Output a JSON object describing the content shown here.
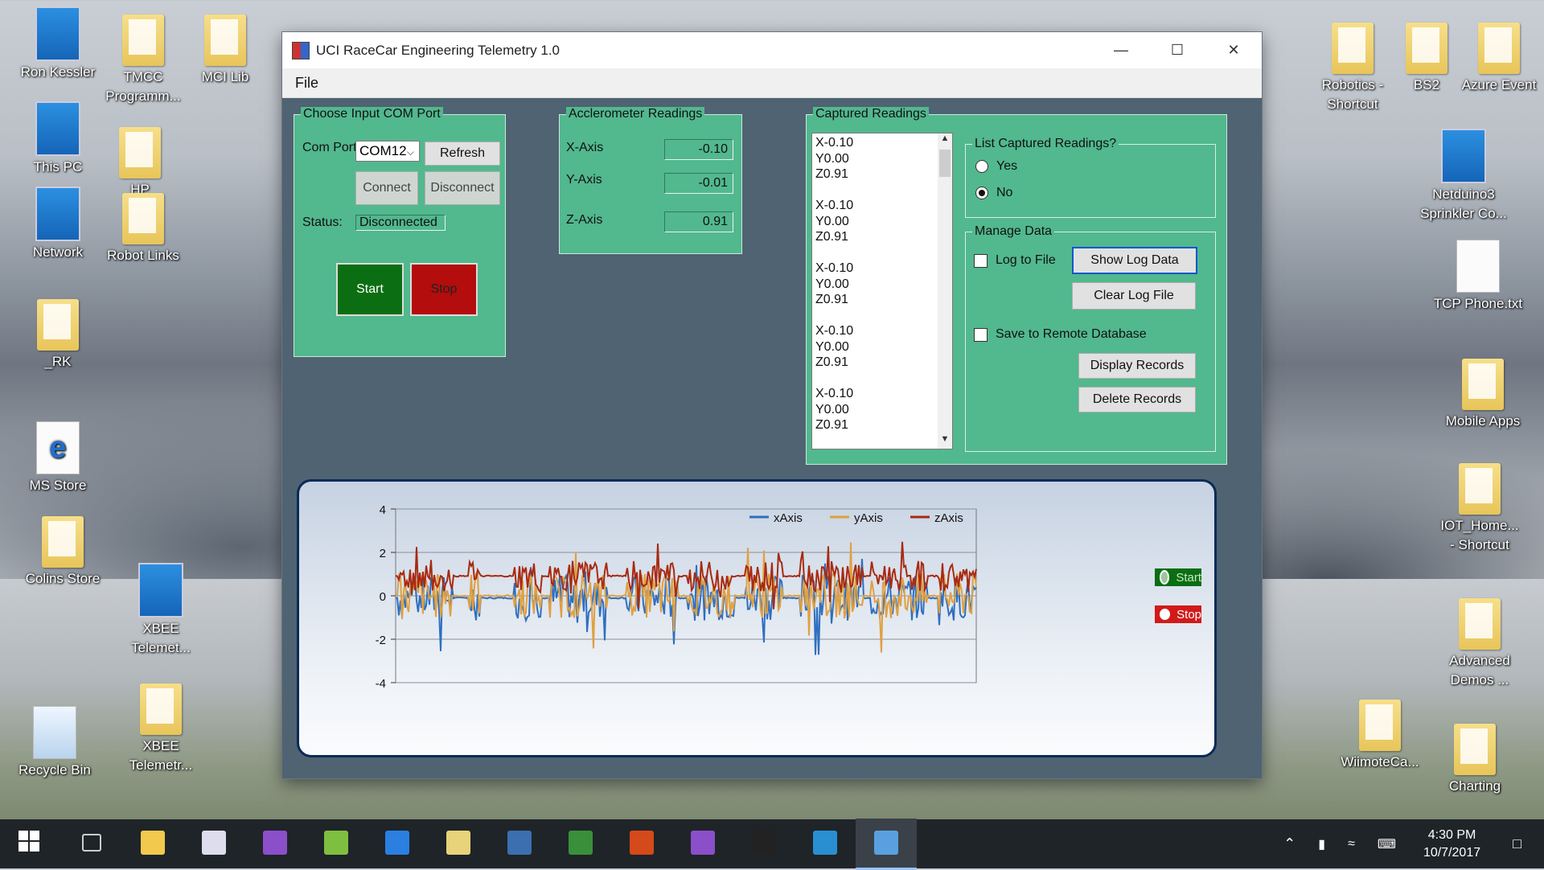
{
  "desktop": {
    "left_icons": [
      {
        "label": "Ron Kessler",
        "kind": "user"
      },
      {
        "label": "TMCC\nProgramm...",
        "kind": "folder"
      },
      {
        "label": "MCI Lib",
        "kind": "folder"
      },
      {
        "label": "This PC",
        "kind": "pc"
      },
      {
        "label": "HP",
        "kind": "folder"
      },
      {
        "label": "Network",
        "kind": "pc"
      },
      {
        "label": "Robot Links",
        "kind": "folder"
      },
      {
        "label": "_RK",
        "kind": "folder"
      },
      {
        "label": "MS Store",
        "kind": "edge"
      },
      {
        "label": "Colins Store",
        "kind": "folder"
      },
      {
        "label": "XBEE\nTelemet...",
        "kind": "app"
      },
      {
        "label": "Recycle Bin",
        "kind": "bin"
      },
      {
        "label": "XBEE\nTelemetr...",
        "kind": "folder"
      }
    ],
    "right_icons": [
      {
        "label": "Robotics -\nShortcut",
        "kind": "folder"
      },
      {
        "label": "BS2",
        "kind": "folder"
      },
      {
        "label": "Azure Event",
        "kind": "folder"
      },
      {
        "label": "Netduino3\nSprinkler Co...",
        "kind": "app"
      },
      {
        "label": "TCP Phone.txt",
        "kind": "doc"
      },
      {
        "label": "Mobile Apps",
        "kind": "folder"
      },
      {
        "label": "IOT_Home...\n- Shortcut",
        "kind": "folder"
      },
      {
        "label": "Advanced\nDemos ...",
        "kind": "folder"
      },
      {
        "label": "WiimoteCa...",
        "kind": "folder"
      },
      {
        "label": "Charting",
        "kind": "folder"
      }
    ]
  },
  "window": {
    "title": "UCI RaceCar Engineering Telemetry  1.0",
    "minimize": "—",
    "maximize": "☐",
    "close": "✕"
  },
  "menu": {
    "file": "File"
  },
  "com_group": {
    "title": "Choose Input COM Port",
    "com_label": "Com Port:",
    "com_value": "COM12",
    "refresh": "Refresh",
    "connect": "Connect",
    "disconnect": "Disconnect",
    "status_label": "Status:",
    "status_value": "Disconnected",
    "start": "Start",
    "stop": "Stop",
    "start_color": "#0b6e12",
    "stop_color": "#b30d0d"
  },
  "accel_group": {
    "title": "Acclerometer Readings",
    "x_label": "X-Axis",
    "x_value": "-0.10",
    "y_label": "Y-Axis",
    "y_value": "-0.01",
    "z_label": "Z-Axis",
    "z_value": "0.91"
  },
  "captured_group": {
    "title": "Captured Readings",
    "items": [
      "X-0.10",
      "Y0.00",
      "Z0.91",
      "",
      "X-0.10",
      "Y0.00",
      "Z0.91",
      "",
      "X-0.10",
      "Y0.00",
      "Z0.91",
      "",
      "X-0.10",
      "Y0.00",
      "Z0.91",
      "",
      "X-0.10",
      "Y0.00",
      "Z0.91"
    ],
    "list_title": "List Captured Readings?",
    "yes": "Yes",
    "no": "No",
    "selected": "No",
    "manage_title": "Manage Data",
    "log_to_file": "Log to File",
    "show_log": "Show Log Data",
    "clear_log": "Clear Log File",
    "save_remote": "Save to Remote Database",
    "display_records": "Display Records",
    "delete_records": "Delete Records"
  },
  "chart_leds": {
    "start": "Start",
    "stop": "Stop"
  },
  "chart_data": {
    "type": "line",
    "ylim": [
      -4,
      4
    ],
    "yticks": [
      "4",
      "2",
      "0",
      "-2",
      "-4"
    ],
    "series": [
      {
        "name": "xAxis",
        "color": "#2f6fc0",
        "baseline": -0.1
      },
      {
        "name": "yAxis",
        "color": "#e0a040",
        "baseline": 0.0
      },
      {
        "name": "zAxis",
        "color": "#a82a10",
        "baseline": 0.91
      }
    ],
    "legend": "top-right",
    "grid": true
  },
  "taskbar": {
    "apps": [
      "start",
      "task-view",
      "file-explorer",
      "store",
      "visual-studio",
      "minecraft",
      "edge",
      "folder",
      "remote-desktop",
      "circuit",
      "office",
      "visual-studio-2",
      "scope",
      "earth",
      "telemetry-app"
    ],
    "time": "4:30 PM",
    "date": "10/7/2017"
  }
}
